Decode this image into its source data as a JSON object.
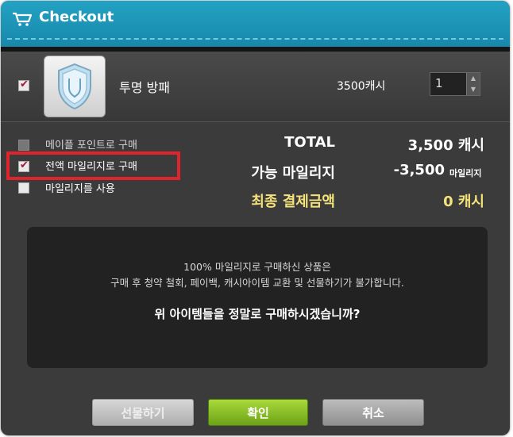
{
  "window": {
    "title": "Checkout"
  },
  "item": {
    "name": "투명 방패",
    "price": "3500캐시",
    "quantity": "1",
    "checked": true
  },
  "payment_options": [
    {
      "label": "메이플 포인트로 구매",
      "checked": false,
      "enabled": false
    },
    {
      "label": "전액 마일리지로 구매",
      "checked": true,
      "enabled": true,
      "highlighted": true
    },
    {
      "label": "마일리지를 사용",
      "checked": false,
      "enabled": true
    }
  ],
  "summary": {
    "total_label": "TOTAL",
    "total_value": "3,500 캐시",
    "mileage_label": "가능 마일리지",
    "mileage_value": "-3,500",
    "mileage_unit": "마일리지",
    "final_label": "최종 결제금액",
    "final_value": "0 캐시"
  },
  "notice": {
    "line1": "100% 마일리지로 구매하신 상품은",
    "line2": "구매 후 청약 철회, 페이백, 캐시아이템 교환 및 선물하기가 불가합니다.",
    "question": "위 아이템들을 정말로 구매하시겠습니까?"
  },
  "buttons": {
    "gift": "선물하기",
    "confirm": "확인",
    "cancel": "취소"
  },
  "colors": {
    "title_bar": "#1f98bb",
    "highlight_box": "#e0242e",
    "final_amount": "#f4e27a",
    "confirm_button": "#7fb524"
  }
}
